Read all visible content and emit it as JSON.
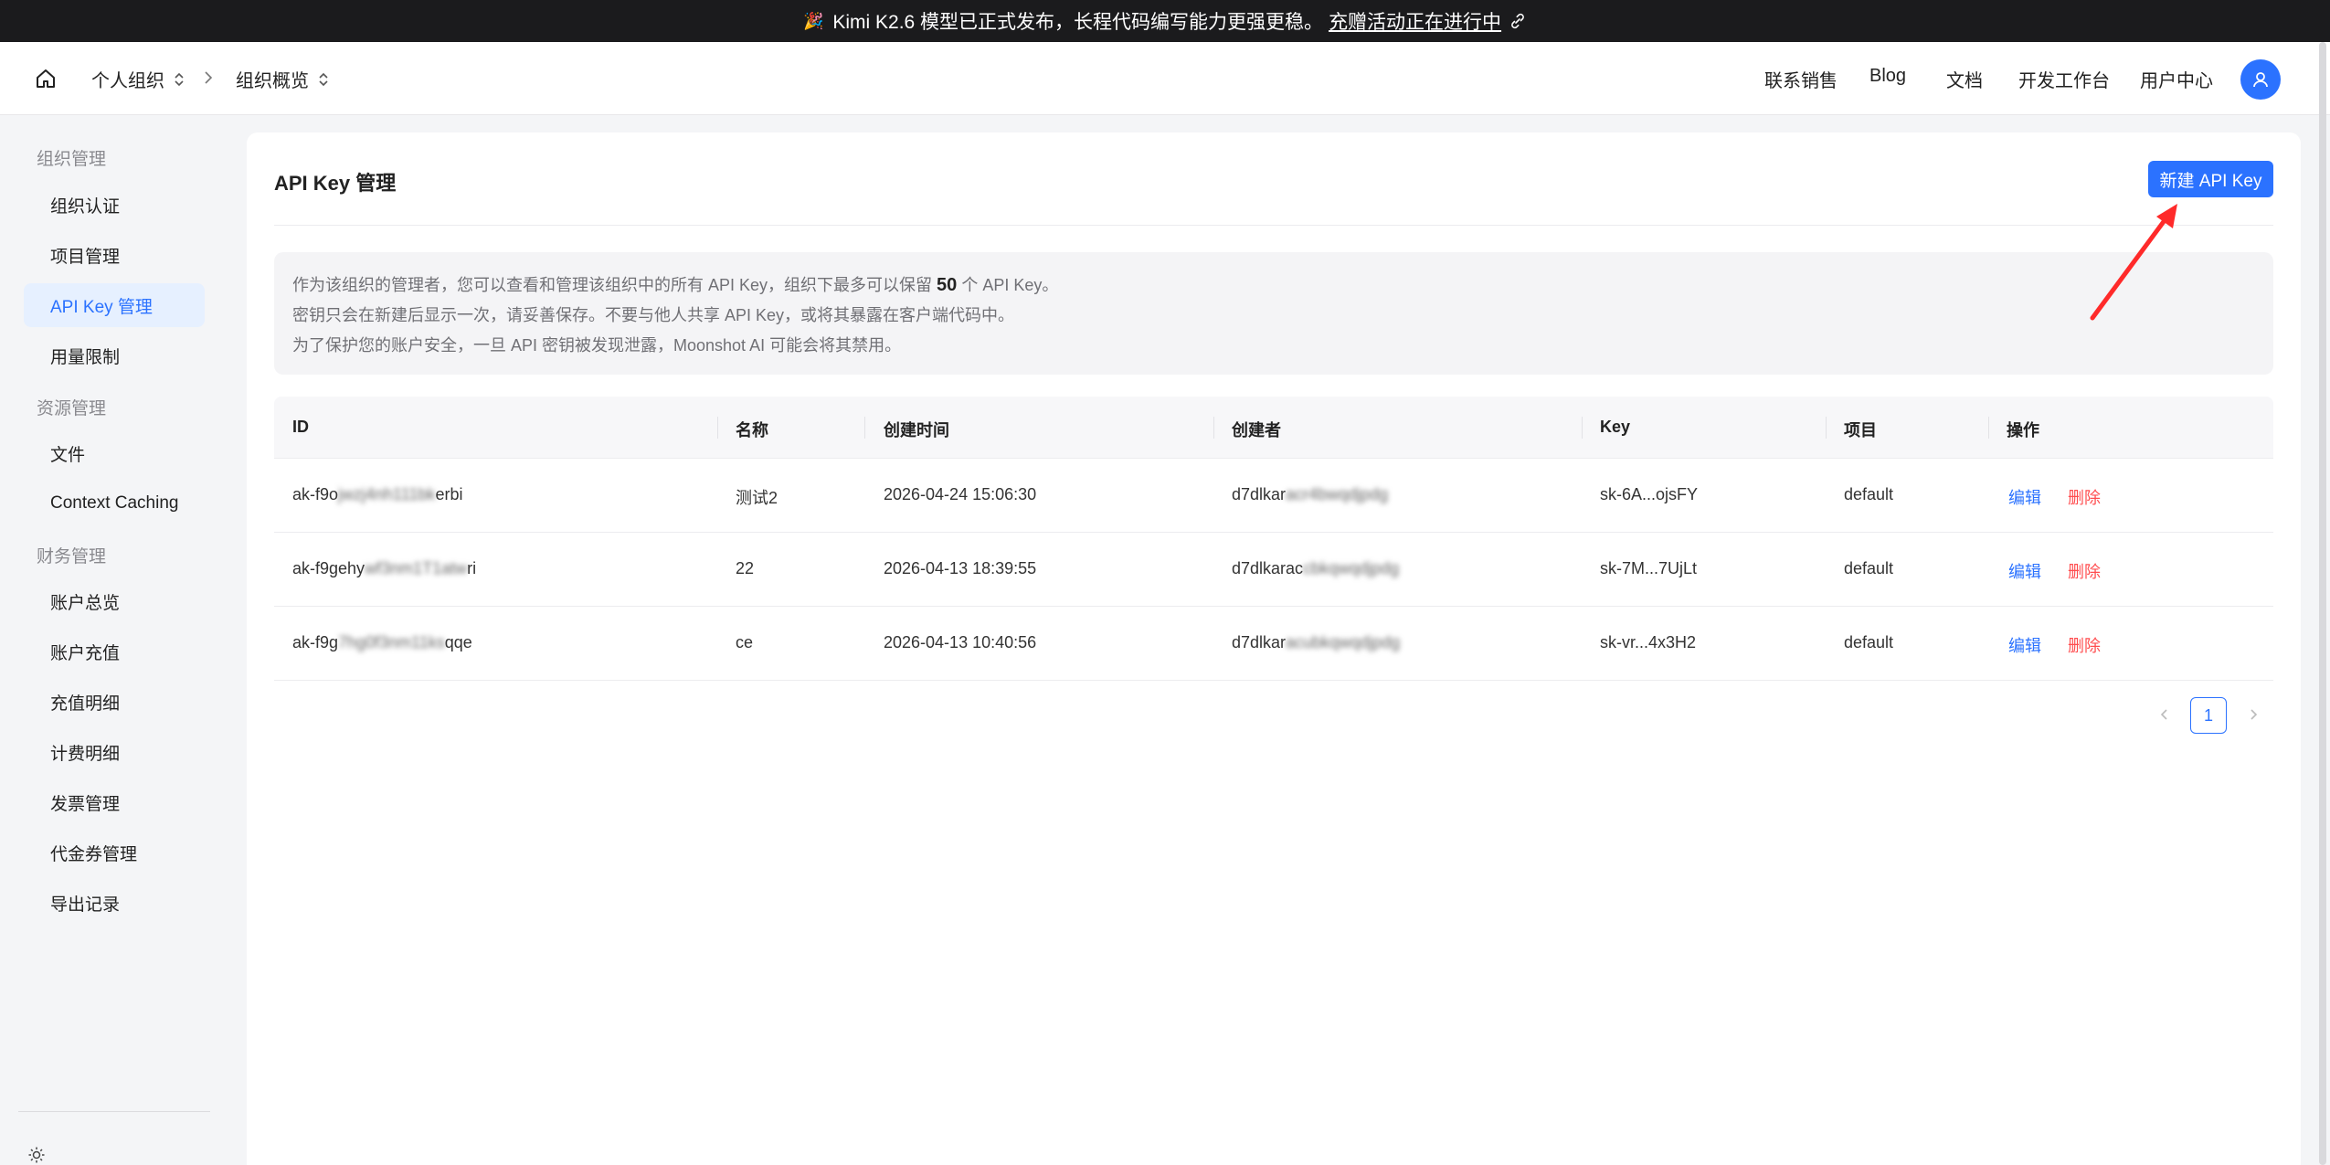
{
  "banner": {
    "text": "Kimi K2.6 模型已正式发布，长程代码编写能力更强更稳。",
    "link": "充赠活动正在进行中"
  },
  "header": {
    "org": "个人组织",
    "page": "组织概览",
    "nav": [
      "联系销售",
      "Blog",
      "文档",
      "开发工作台",
      "用户中心"
    ]
  },
  "sidebar": {
    "groups": [
      {
        "label": "组织管理",
        "items": [
          "组织认证",
          "项目管理",
          "API Key 管理",
          "用量限制"
        ]
      },
      {
        "label": "资源管理",
        "items": [
          "文件",
          "Context Caching"
        ]
      },
      {
        "label": "财务管理",
        "items": [
          "账户总览",
          "账户充值",
          "充值明细",
          "计费明细",
          "发票管理",
          "代金券管理",
          "导出记录"
        ]
      }
    ],
    "active": "API Key 管理"
  },
  "main": {
    "title": "API Key 管理",
    "new_button": "新建 API Key",
    "notice": {
      "line1_pre": "作为该组织的管理者，您可以查看和管理该组织中的所有 API Key，组织下最多可以保留",
      "line1_num": "50",
      "line1_post": "个 API Key。",
      "line2": "密钥只会在新建后显示一次，请妥善保存。不要与他人共享 API Key，或将其暴露在客户端代码中。",
      "line3": "为了保护您的账户安全，一旦 API 密钥被发现泄露，Moonshot AI 可能会将其禁用。"
    },
    "table": {
      "columns": [
        "ID",
        "名称",
        "创建时间",
        "创建者",
        "Key",
        "项目",
        "操作"
      ],
      "rows": [
        {
          "id_a": "ak-f9o",
          "id_b": "jwzj4nh111bk",
          "id_c": "erbi",
          "name": "测试2",
          "created": "2026-04-24 15:06:30",
          "creator_a": "d7dlkar",
          "creator_b": "acr4bwqdjpdg",
          "key": "sk-6A...ojsFY",
          "project": "default",
          "edit": "编辑",
          "delete": "删除"
        },
        {
          "id_a": "ak-f9gehy",
          "id_b": "wf3nm1T1atw",
          "id_c": "ri",
          "name": "22",
          "created": "2026-04-13 18:39:55",
          "creator_a": "d7dlkarac",
          "creator_b": "cbkqwqdjpdg",
          "key": "sk-7M...7UjLt",
          "project": "default",
          "edit": "编辑",
          "delete": "删除"
        },
        {
          "id_a": "ak-f9g",
          "id_b": "7hg0f3nm11ks",
          "id_c": "qqe",
          "name": "ce",
          "created": "2026-04-13 10:40:56",
          "creator_a": "d7dlkar",
          "creator_b": "acubkqwqdjpdg",
          "key": "sk-vr...4x3H2",
          "project": "default",
          "edit": "编辑",
          "delete": "删除"
        }
      ]
    },
    "pagination": {
      "current": "1"
    }
  },
  "colors": {
    "accent": "#2b72ff",
    "danger": "#ff4d4f",
    "banner_bg": "#1b1b1d",
    "annotation": "#ff2a2a"
  }
}
